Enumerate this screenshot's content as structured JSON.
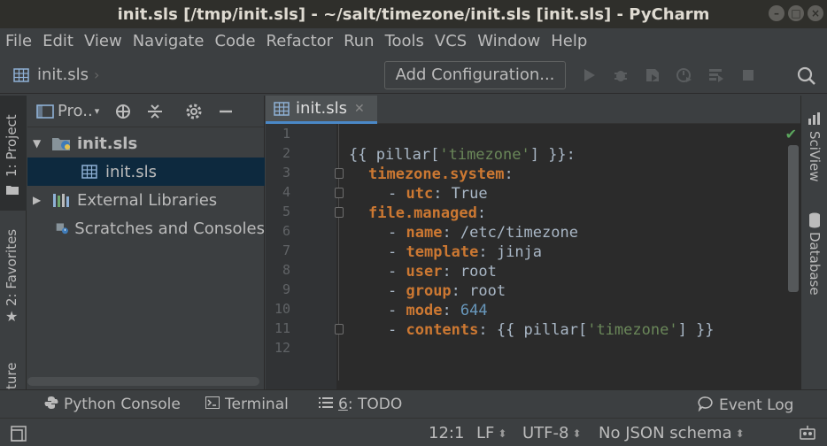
{
  "window": {
    "title": "init.sls [/tmp/init.sls] - ~/salt/timezone/init.sls [init.sls] - PyCharm"
  },
  "menu": {
    "items": [
      "File",
      "Edit",
      "View",
      "Navigate",
      "Code",
      "Refactor",
      "Run",
      "Tools",
      "VCS",
      "Window",
      "Help"
    ]
  },
  "navbar": {
    "breadcrumb": "init.sls",
    "add_configuration": "Add Configuration..."
  },
  "left_tabs": {
    "project": "1: Project",
    "favorites": "2: Favorites",
    "structure": "ture"
  },
  "right_tabs": {
    "sciview": "SciView",
    "database": "Database"
  },
  "project_panel": {
    "title": "Pro..",
    "tree": [
      {
        "label": "init.sls",
        "level": 0,
        "expanded": true,
        "bold": true
      },
      {
        "label": "init.sls",
        "level": 1,
        "selected": true
      },
      {
        "label": "External Libraries",
        "level": 0,
        "expanded": false
      },
      {
        "label": "Scratches and Consoles",
        "level": 0
      }
    ]
  },
  "editor": {
    "tab_label": "init.sls",
    "line_numbers": [
      "1",
      "2",
      "3",
      "4",
      "5",
      "6",
      "7",
      "8",
      "9",
      "10",
      "11",
      "12"
    ],
    "code": {
      "l2a": "{{ pillar[",
      "l2b": "'timezone'",
      "l2c": "] }}:",
      "l3k": "timezone.system",
      "l3c": ":",
      "l4a": "- ",
      "l4k": "utc",
      "l4b": ": True",
      "l5k": "file.managed",
      "l5c": ":",
      "l6a": "- ",
      "l6k": "name",
      "l6b": ": /etc/timezone",
      "l7a": "- ",
      "l7k": "template",
      "l7b": ": jinja",
      "l8a": "- ",
      "l8k": "user",
      "l8b": ": root",
      "l9a": "- ",
      "l9k": "group",
      "l9b": ": root",
      "l10a": "- ",
      "l10k": "mode",
      "l10b": ": ",
      "l10n": "644",
      "l11a": "- ",
      "l11k": "contents",
      "l11b": ": {{ pillar[",
      "l11s": "'timezone'",
      "l11c": "] }}"
    }
  },
  "bottom_tools": {
    "python_console": "Python Console",
    "terminal": "Terminal",
    "todo_num": "6",
    "todo": ": TODO",
    "event_log": "Event Log"
  },
  "status": {
    "position": "12:1",
    "line_sep": "LF",
    "encoding": "UTF-8",
    "schema": "No JSON schema"
  },
  "colors": {
    "keyword": "#cc7832",
    "string": "#6a8759",
    "number": "#6897bb",
    "selection": "#0d293e",
    "tab_underline": "#4a88c7"
  }
}
